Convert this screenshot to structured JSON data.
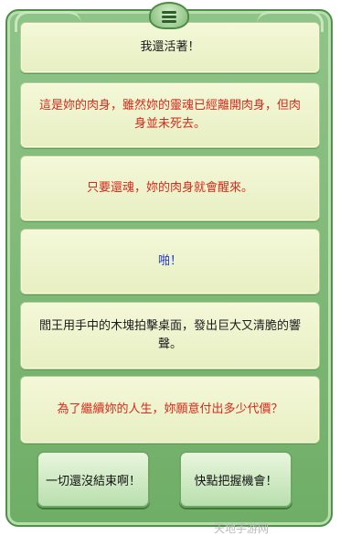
{
  "dialogue": [
    {
      "text": "我還活著！",
      "color": "#1b1b1b"
    },
    {
      "text": "這是妳的肉身，雖然妳的靈魂已經離開肉身，但肉身並未死去。",
      "color": "#d72a1c"
    },
    {
      "text": "只要還魂，妳的肉身就會醒來。",
      "color": "#d72a1c"
    },
    {
      "text": "啪！",
      "color": "#1f37c8"
    },
    {
      "text": "閻王用手中的木塊拍擊桌面，發出巨大又清脆的響聲。",
      "color": "#1b1b1b"
    },
    {
      "text": "為了繼續妳的人生，妳願意付出多少代價？",
      "color": "#d72a1c"
    }
  ],
  "choices": [
    {
      "label": "一切還沒結束啊！"
    },
    {
      "label": "快點把握機會！"
    }
  ],
  "watermark": "天地手游网",
  "icons": {
    "menu": "hamburger-menu-icon"
  },
  "colors": {
    "panel": "#7cb874",
    "bubble": "#eef3cf"
  }
}
